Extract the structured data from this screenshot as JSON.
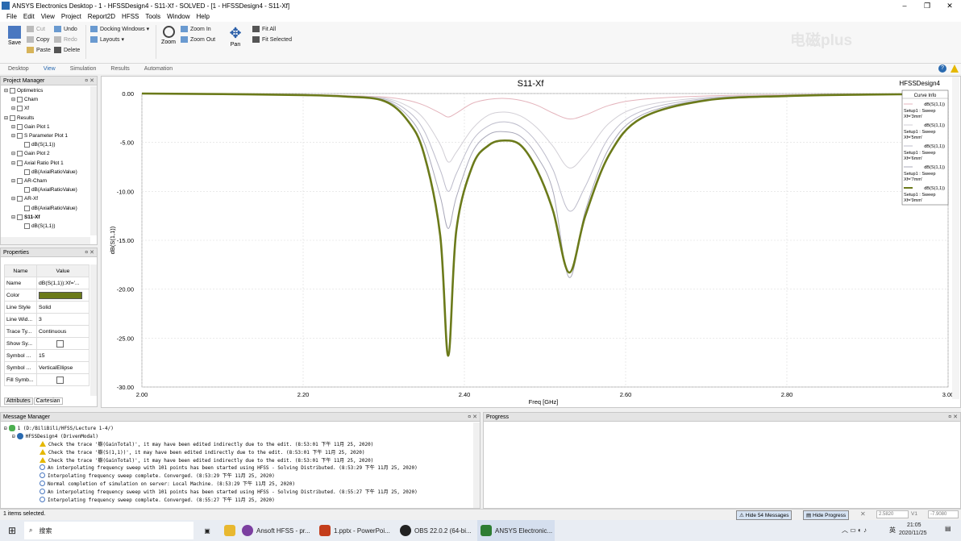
{
  "window": {
    "title": "ANSYS Electronics Desktop - 1 - HFSSDesign4 - S11-Xf - SOLVED - [1 - HFSSDesign4 - S11-Xf]"
  },
  "menu": [
    "File",
    "Edit",
    "View",
    "Project",
    "Report2D",
    "HFSS",
    "Tools",
    "Window",
    "Help"
  ],
  "ribbon": {
    "save": "Save",
    "cut": "Cut",
    "copy": "Copy",
    "paste": "Paste",
    "undo": "Undo",
    "redo": "Redo",
    "delete": "Delete",
    "docking": "Docking Windows",
    "layouts": "Layouts",
    "zoom": "Zoom",
    "zoom_in": "Zoom In",
    "zoom_out": "Zoom Out",
    "pan": "Pan",
    "fit_all": "Fit All",
    "fit_selected": "Fit Selected"
  },
  "tabs": [
    "Desktop",
    "View",
    "Simulation",
    "Results",
    "Automation"
  ],
  "project_manager": {
    "title": "Project Manager",
    "tree": [
      {
        "label": "Optimetrics",
        "indent": 0
      },
      {
        "label": "Cham",
        "indent": 1
      },
      {
        "label": "Xf",
        "indent": 1
      },
      {
        "label": "Results",
        "indent": 0
      },
      {
        "label": "Gain Plot 1",
        "indent": 1
      },
      {
        "label": "S Parameter Plot 1",
        "indent": 1
      },
      {
        "label": "dB(S(1,1))",
        "indent": 2
      },
      {
        "label": "Gain Plot 2",
        "indent": 1
      },
      {
        "label": "Axial Ratio Plot 1",
        "indent": 1
      },
      {
        "label": "dB(AxialRatioValue)",
        "indent": 2
      },
      {
        "label": "AR-Cham",
        "indent": 1
      },
      {
        "label": "dB(AxialRatioValue)",
        "indent": 2
      },
      {
        "label": "AR-Xf",
        "indent": 1
      },
      {
        "label": "dB(AxialRatioValue)",
        "indent": 2
      },
      {
        "label": "S11-Xf",
        "indent": 1
      },
      {
        "label": "dB(S(1,1))",
        "indent": 2
      }
    ]
  },
  "properties": {
    "title": "Properties",
    "header_name": "Name",
    "header_value": "Value",
    "rows": [
      {
        "name": "Name",
        "value": "dB(S(1,1)):Xf='...",
        "type": "text"
      },
      {
        "name": "Color",
        "value": "",
        "type": "color"
      },
      {
        "name": "Line Style",
        "value": "Solid",
        "type": "text"
      },
      {
        "name": "Line Wid...",
        "value": "3",
        "type": "text"
      },
      {
        "name": "Trace Ty...",
        "value": "Continuous",
        "type": "text"
      },
      {
        "name": "Show Sy...",
        "value": "",
        "type": "check"
      },
      {
        "name": "Symbol ...",
        "value": "15",
        "type": "text"
      },
      {
        "name": "Symbol ...",
        "value": "VerticalEllipse",
        "type": "text"
      },
      {
        "name": "Fill Symb...",
        "value": "",
        "type": "check"
      }
    ],
    "tabs": [
      "Attributes",
      "Cartesian"
    ],
    "trace_color": "#6b7a1a"
  },
  "messages": {
    "title": "Message Manager",
    "project": "1 (D:/BiliBili/HFSS/Lecture 1-4/)",
    "design": "HFSSDesign4 (DrivenModal)",
    "lines": [
      {
        "kind": "warn",
        "text": "Check the trace '瓣(GainTotal)', it may have been edited indirectly due to the edit. (8:53:01 下午  11月 25, 2020)"
      },
      {
        "kind": "warn",
        "text": "Check the trace '瓣(S(1,1))', it may have been edited indirectly due to the edit. (8:53:01 下午  11月 25, 2020)"
      },
      {
        "kind": "warn",
        "text": "Check the trace '瓣(GainTotal)', it may have been edited indirectly due to the edit. (8:53:01 下午  11月 25, 2020)"
      },
      {
        "kind": "info",
        "text": "An interpolating frequency sweep with 101 points has been started using HFSS - Solving Distributed. (8:53:29 下午  11月 25, 2020)"
      },
      {
        "kind": "info",
        "text": "Interpolating frequency sweep complete. Converged. (8:53:29 下午  11月 25, 2020)"
      },
      {
        "kind": "info",
        "text": "Normal completion of simulation on server: Local Machine. (8:53:29 下午  11月 25, 2020)"
      },
      {
        "kind": "info",
        "text": "An interpolating frequency sweep with 101 points has been started using HFSS - Solving Distributed. (8:55:27 下午  11月 25, 2020)"
      },
      {
        "kind": "info",
        "text": "Interpolating frequency sweep complete. Converged. (8:55:27 下午  11月 25, 2020)"
      }
    ]
  },
  "progress": {
    "title": "Progress"
  },
  "status": {
    "left": "1 items selected.",
    "hide_messages": "Hide 54 Messages",
    "hide_progress": "Hide Progress",
    "x": "2.5820",
    "y": "-7.9080",
    "v1": "V1"
  },
  "taskbar": {
    "search": "搜索",
    "apps": [
      "Ansoft HFSS - pr...",
      "1.pptx - PowerPoi...",
      "OBS 22.0.2 (64-bi...",
      "ANSYS Electronic..."
    ],
    "time": "21:05",
    "date": "2020/11/25",
    "ime": "英"
  },
  "watermark": "电磁plus",
  "chart_data": {
    "type": "line",
    "title": "S11-Xf",
    "design_label": "HFSSDesign4",
    "xlabel": "Freq [GHz]",
    "ylabel": "dB(S(1,1))",
    "xlim": [
      2.0,
      3.0
    ],
    "ylim": [
      -30,
      0
    ],
    "xticks": [
      "2.00",
      "2.20",
      "2.40",
      "2.60",
      "2.80",
      "3.00"
    ],
    "yticks": [
      "0.00",
      "-5.00",
      "-10.00",
      "-15.00",
      "-20.00",
      "-25.00",
      "-30.00"
    ],
    "legend_title": "Curve Info",
    "legend_position": "top-right",
    "grid": true,
    "x": [
      2.0,
      2.1,
      2.2,
      2.25,
      2.3,
      2.33,
      2.35,
      2.37,
      2.38,
      2.39,
      2.41,
      2.43,
      2.45,
      2.47,
      2.49,
      2.51,
      2.53,
      2.55,
      2.58,
      2.62,
      2.7,
      2.8,
      2.9,
      3.0
    ],
    "series": [
      {
        "name": "dB(S(1,1)) Setup1 : Sweep Xf='3mm'",
        "color": "#e4b4bc",
        "width": 1,
        "values": [
          -0.0,
          -0.05,
          -0.12,
          -0.2,
          -0.35,
          -0.7,
          -1.2,
          -2.0,
          -2.4,
          -2.0,
          -1.0,
          -0.6,
          -0.5,
          -0.7,
          -1.2,
          -2.0,
          -2.6,
          -2.2,
          -1.2,
          -0.6,
          -0.25,
          -0.12,
          -0.06,
          -0.03
        ]
      },
      {
        "name": "dB(S(1,1)) Setup1 : Sweep Xf='5mm'",
        "color": "#d2cfd6",
        "width": 1,
        "values": [
          -0.0,
          -0.05,
          -0.13,
          -0.22,
          -0.45,
          -1.3,
          -2.6,
          -5.2,
          -7.0,
          -6.0,
          -3.6,
          -2.2,
          -1.9,
          -2.3,
          -3.5,
          -5.4,
          -7.6,
          -6.2,
          -3.0,
          -1.3,
          -0.4,
          -0.16,
          -0.08,
          -0.04
        ]
      },
      {
        "name": "dB(S(1,1)) Setup1 : Sweep Xf='6mm'",
        "color": "#bdbccb",
        "width": 1,
        "values": [
          -0.0,
          -0.05,
          -0.14,
          -0.25,
          -0.55,
          -1.8,
          -3.8,
          -7.8,
          -10.0,
          -8.2,
          -4.8,
          -3.3,
          -2.9,
          -3.4,
          -5.0,
          -7.8,
          -12.0,
          -9.5,
          -4.4,
          -1.8,
          -0.5,
          -0.2,
          -0.09,
          -0.04
        ]
      },
      {
        "name": "dB(S(1,1)) Setup1 : Sweep Xf='7mm'",
        "color": "#a9a8b9",
        "width": 1,
        "values": [
          -0.0,
          -0.05,
          -0.15,
          -0.28,
          -0.65,
          -2.3,
          -5.0,
          -10.5,
          -13.8,
          -10.6,
          -6.0,
          -4.2,
          -3.9,
          -4.4,
          -6.4,
          -10.0,
          -18.8,
          -12.0,
          -5.5,
          -2.2,
          -0.6,
          -0.22,
          -0.1,
          -0.05
        ]
      },
      {
        "name": "dB(S(1,1)) Setup1 : Sweep Xf='9mm'",
        "color": "#6b7a1a",
        "width": 2.6,
        "values": [
          -0.0,
          -0.06,
          -0.16,
          -0.3,
          -0.75,
          -2.8,
          -6.2,
          -14.5,
          -26.8,
          -14.0,
          -7.4,
          -5.3,
          -4.8,
          -5.3,
          -7.8,
          -12.0,
          -18.3,
          -12.5,
          -6.2,
          -2.5,
          -0.7,
          -0.25,
          -0.11,
          -0.05
        ]
      }
    ]
  }
}
